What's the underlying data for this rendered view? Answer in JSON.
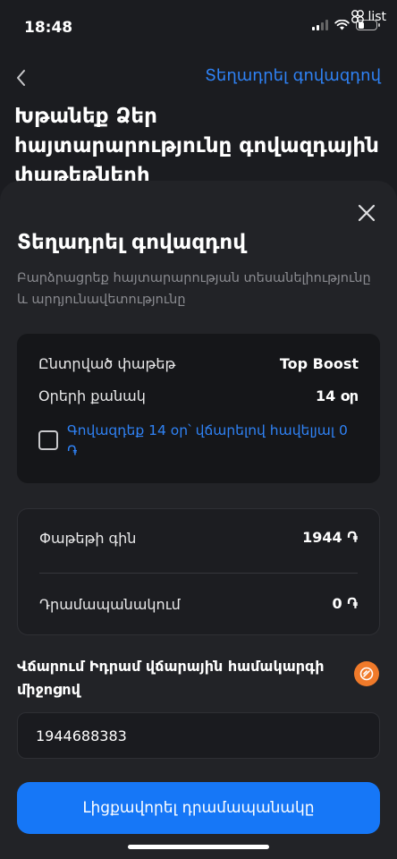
{
  "status_bar": {
    "time": "18:48",
    "list_label": "list"
  },
  "background_page": {
    "back_icon": "chevron-left-icon",
    "top_action": "Տեղադրել գովազդով",
    "title": "Խթանեք Ձեր հայտարարությունը գովազդային փաթեթների"
  },
  "sheet": {
    "title": "Տեղադրել գովազդով",
    "subtitle": "Բարձրացրեք հայտարարության տեսանելիությունը և արդյունավետությունը",
    "package_card": {
      "selected_package_label": "Ընտրված փաթեթ",
      "selected_package_value": "Top Boost",
      "days_label": "Օրերի քանակ",
      "days_value": "14 օր",
      "checkbox_label": "Գովազդեք 14 օր՝ վճարելով հավելյալ 0 ֏",
      "checkbox_checked": false
    },
    "price_card": {
      "package_price_label": "Փաթեթի գին",
      "package_price_value": "1944 ֏",
      "wallet_label": "Դրամապանակում",
      "wallet_value": "0 ֏"
    },
    "payment": {
      "label": "Վճարում Իդրամ վճարային համակարգի միջոցով",
      "logo_icon": "idram-logo-icon",
      "logo_color": "#f07a2a",
      "account_value": "1944688383"
    },
    "primary_button": "Լիցքավորել դրամապանակը"
  },
  "colors": {
    "accent": "#1677f7",
    "link": "#2f82f5",
    "sheet_bg": "#222327",
    "card_bg": "#151619"
  }
}
